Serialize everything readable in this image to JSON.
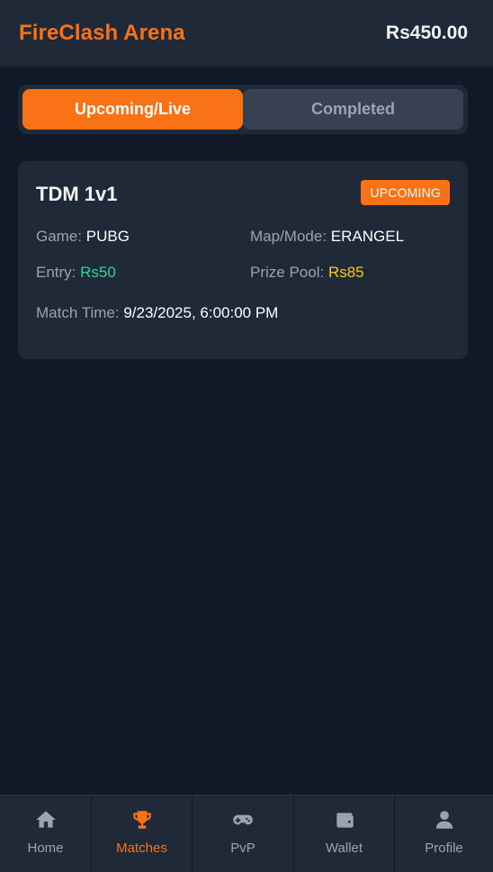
{
  "header": {
    "brand": "FireClash Arena",
    "balance": "Rs450.00"
  },
  "tabs": [
    {
      "label": "Upcoming/Live",
      "active": true
    },
    {
      "label": "Completed",
      "active": false
    }
  ],
  "match": {
    "title": "TDM 1v1",
    "status": "UPCOMING",
    "game_label": "Game:",
    "game_value": "PUBG",
    "map_label": "Map/Mode:",
    "map_value": "ERANGEL",
    "entry_label": "Entry:",
    "entry_value": "Rs50",
    "prize_label": "Prize Pool:",
    "prize_value": "Rs85",
    "time_label": "Match Time:",
    "time_value": "9/23/2025, 6:00:00 PM"
  },
  "nav": [
    {
      "label": "Home",
      "icon": "home-icon",
      "active": false
    },
    {
      "label": "Matches",
      "icon": "trophy-icon",
      "active": true
    },
    {
      "label": "PvP",
      "icon": "gamepad-icon",
      "active": false
    },
    {
      "label": "Wallet",
      "icon": "wallet-icon",
      "active": false
    },
    {
      "label": "Profile",
      "icon": "user-icon",
      "active": false
    }
  ],
  "colors": {
    "accent": "#f97316",
    "background": "#111827",
    "surface": "#1f2937",
    "entry": "#34d399",
    "prize": "#facc15"
  }
}
